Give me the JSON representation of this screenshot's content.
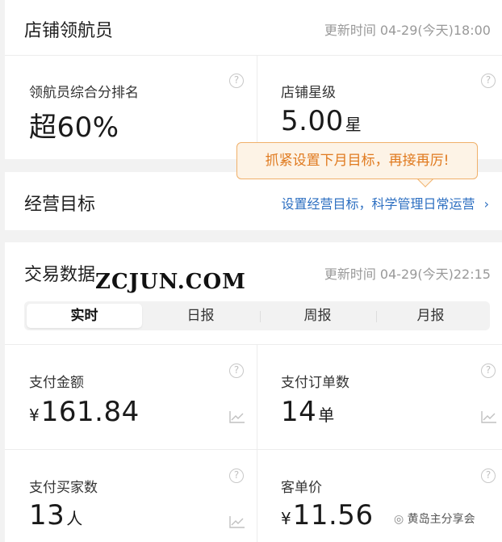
{
  "shop_nav": {
    "title": "店铺领航员",
    "updated": "更新时间 04-29(今天)18:00",
    "score_label": "领航员综合分排名",
    "score_value": "超60%",
    "star_label": "店铺星级",
    "star_value": "5.00",
    "star_unit": "星"
  },
  "tooltip": "抓紧设置下月目标，再接再厉!",
  "goal": {
    "title": "经营目标",
    "link": "设置经营目标，科学管理日常运营"
  },
  "trade": {
    "title": "交易数据",
    "updated": "更新时间 04-29(今天)22:15",
    "tabs": [
      "实时",
      "日报",
      "周报",
      "月报"
    ],
    "metrics": {
      "pay_amount": {
        "label": "支付金额",
        "prefix": "¥",
        "value": "161.84"
      },
      "pay_orders": {
        "label": "支付订单数",
        "value": "14",
        "unit": "单"
      },
      "buyers": {
        "label": "支付买家数",
        "value": "13",
        "unit": "人"
      },
      "avg_price": {
        "label": "客单价",
        "prefix": "¥",
        "value": "11.56"
      }
    }
  },
  "watermark": "ZCJUN.COM",
  "wechat_label": "黄岛主分享会"
}
